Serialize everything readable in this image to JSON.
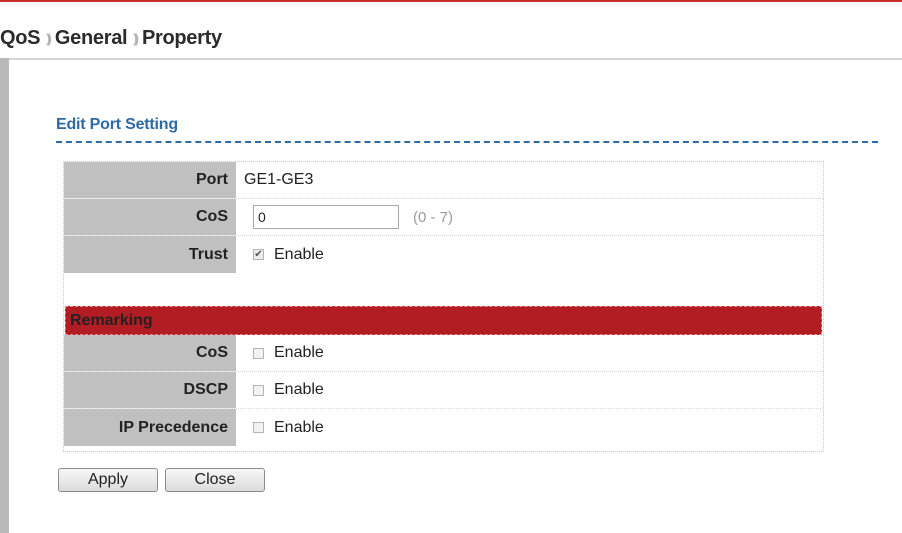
{
  "breadcrumb": {
    "items": [
      "QoS",
      "General",
      "Property"
    ],
    "separator": "))"
  },
  "section": {
    "title": "Edit Port Setting"
  },
  "form": {
    "port": {
      "label": "Port",
      "value": "GE1-GE3"
    },
    "cos": {
      "label": "CoS",
      "value": "0",
      "hint": "(0 - 7)"
    },
    "trust": {
      "label": "Trust",
      "option": "Enable",
      "checked": true
    }
  },
  "remarking": {
    "header": "Remarking",
    "cos": {
      "label": "CoS",
      "option": "Enable",
      "checked": false
    },
    "dscp": {
      "label": "DSCP",
      "option": "Enable",
      "checked": false
    },
    "ip_precedence": {
      "label": "IP Precedence",
      "option": "Enable",
      "checked": false
    }
  },
  "buttons": {
    "apply": "Apply",
    "close": "Close"
  },
  "colors": {
    "accent": "#c9302c",
    "title": "#2e6aa3",
    "remark_bar": "#b11d23",
    "label_bg": "#c0c0c0"
  }
}
